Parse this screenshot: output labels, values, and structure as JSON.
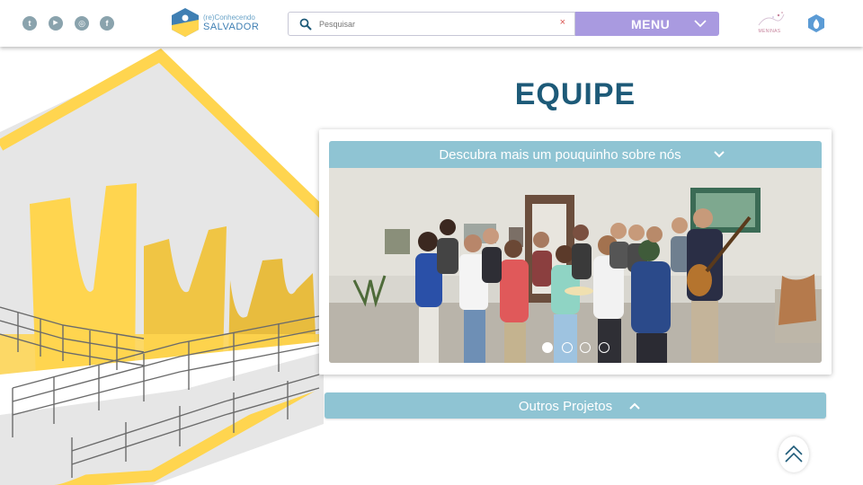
{
  "header": {
    "social_icons": [
      "tumblr-icon",
      "youtube-icon",
      "instagram-icon",
      "facebook-icon"
    ],
    "social_glyphs": [
      "t",
      "▶",
      "◎",
      "f"
    ],
    "logo_small": "(re)Conhecendo",
    "logo_big": "SALVADOR",
    "search_placeholder": "Pesquisar",
    "search_clear": "×",
    "menu_label": "MENU",
    "partner_logo_text": "MENINAS"
  },
  "main": {
    "title": "EQUIPE",
    "accordion_label": "Descubra mais um pouquinho sobre nós",
    "carousel": {
      "slide_count": 4,
      "active_slide": 1
    },
    "other_projects_label": "Outros Projetos"
  },
  "colors": {
    "accent_purple": "#a99ae0",
    "accordion_blue": "#8fc4d3",
    "title_blue": "#1d5a78",
    "yellow": "#ffd54f",
    "logo_blue": "#3f7fb3"
  }
}
